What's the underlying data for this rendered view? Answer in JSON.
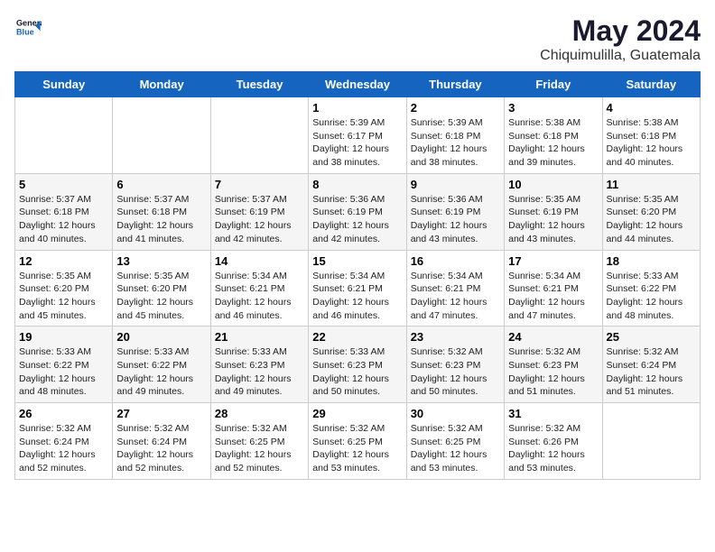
{
  "header": {
    "logo_line1": "General",
    "logo_line2": "Blue",
    "title": "May 2024",
    "subtitle": "Chiquimulilla, Guatemala"
  },
  "calendar": {
    "days_of_week": [
      "Sunday",
      "Monday",
      "Tuesday",
      "Wednesday",
      "Thursday",
      "Friday",
      "Saturday"
    ],
    "weeks": [
      [
        {
          "day": "",
          "content": ""
        },
        {
          "day": "",
          "content": ""
        },
        {
          "day": "",
          "content": ""
        },
        {
          "day": "1",
          "content": "Sunrise: 5:39 AM\nSunset: 6:17 PM\nDaylight: 12 hours\nand 38 minutes."
        },
        {
          "day": "2",
          "content": "Sunrise: 5:39 AM\nSunset: 6:18 PM\nDaylight: 12 hours\nand 38 minutes."
        },
        {
          "day": "3",
          "content": "Sunrise: 5:38 AM\nSunset: 6:18 PM\nDaylight: 12 hours\nand 39 minutes."
        },
        {
          "day": "4",
          "content": "Sunrise: 5:38 AM\nSunset: 6:18 PM\nDaylight: 12 hours\nand 40 minutes."
        }
      ],
      [
        {
          "day": "5",
          "content": "Sunrise: 5:37 AM\nSunset: 6:18 PM\nDaylight: 12 hours\nand 40 minutes."
        },
        {
          "day": "6",
          "content": "Sunrise: 5:37 AM\nSunset: 6:18 PM\nDaylight: 12 hours\nand 41 minutes."
        },
        {
          "day": "7",
          "content": "Sunrise: 5:37 AM\nSunset: 6:19 PM\nDaylight: 12 hours\nand 42 minutes."
        },
        {
          "day": "8",
          "content": "Sunrise: 5:36 AM\nSunset: 6:19 PM\nDaylight: 12 hours\nand 42 minutes."
        },
        {
          "day": "9",
          "content": "Sunrise: 5:36 AM\nSunset: 6:19 PM\nDaylight: 12 hours\nand 43 minutes."
        },
        {
          "day": "10",
          "content": "Sunrise: 5:35 AM\nSunset: 6:19 PM\nDaylight: 12 hours\nand 43 minutes."
        },
        {
          "day": "11",
          "content": "Sunrise: 5:35 AM\nSunset: 6:20 PM\nDaylight: 12 hours\nand 44 minutes."
        }
      ],
      [
        {
          "day": "12",
          "content": "Sunrise: 5:35 AM\nSunset: 6:20 PM\nDaylight: 12 hours\nand 45 minutes."
        },
        {
          "day": "13",
          "content": "Sunrise: 5:35 AM\nSunset: 6:20 PM\nDaylight: 12 hours\nand 45 minutes."
        },
        {
          "day": "14",
          "content": "Sunrise: 5:34 AM\nSunset: 6:21 PM\nDaylight: 12 hours\nand 46 minutes."
        },
        {
          "day": "15",
          "content": "Sunrise: 5:34 AM\nSunset: 6:21 PM\nDaylight: 12 hours\nand 46 minutes."
        },
        {
          "day": "16",
          "content": "Sunrise: 5:34 AM\nSunset: 6:21 PM\nDaylight: 12 hours\nand 47 minutes."
        },
        {
          "day": "17",
          "content": "Sunrise: 5:34 AM\nSunset: 6:21 PM\nDaylight: 12 hours\nand 47 minutes."
        },
        {
          "day": "18",
          "content": "Sunrise: 5:33 AM\nSunset: 6:22 PM\nDaylight: 12 hours\nand 48 minutes."
        }
      ],
      [
        {
          "day": "19",
          "content": "Sunrise: 5:33 AM\nSunset: 6:22 PM\nDaylight: 12 hours\nand 48 minutes."
        },
        {
          "day": "20",
          "content": "Sunrise: 5:33 AM\nSunset: 6:22 PM\nDaylight: 12 hours\nand 49 minutes."
        },
        {
          "day": "21",
          "content": "Sunrise: 5:33 AM\nSunset: 6:23 PM\nDaylight: 12 hours\nand 49 minutes."
        },
        {
          "day": "22",
          "content": "Sunrise: 5:33 AM\nSunset: 6:23 PM\nDaylight: 12 hours\nand 50 minutes."
        },
        {
          "day": "23",
          "content": "Sunrise: 5:32 AM\nSunset: 6:23 PM\nDaylight: 12 hours\nand 50 minutes."
        },
        {
          "day": "24",
          "content": "Sunrise: 5:32 AM\nSunset: 6:23 PM\nDaylight: 12 hours\nand 51 minutes."
        },
        {
          "day": "25",
          "content": "Sunrise: 5:32 AM\nSunset: 6:24 PM\nDaylight: 12 hours\nand 51 minutes."
        }
      ],
      [
        {
          "day": "26",
          "content": "Sunrise: 5:32 AM\nSunset: 6:24 PM\nDaylight: 12 hours\nand 52 minutes."
        },
        {
          "day": "27",
          "content": "Sunrise: 5:32 AM\nSunset: 6:24 PM\nDaylight: 12 hours\nand 52 minutes."
        },
        {
          "day": "28",
          "content": "Sunrise: 5:32 AM\nSunset: 6:25 PM\nDaylight: 12 hours\nand 52 minutes."
        },
        {
          "day": "29",
          "content": "Sunrise: 5:32 AM\nSunset: 6:25 PM\nDaylight: 12 hours\nand 53 minutes."
        },
        {
          "day": "30",
          "content": "Sunrise: 5:32 AM\nSunset: 6:25 PM\nDaylight: 12 hours\nand 53 minutes."
        },
        {
          "day": "31",
          "content": "Sunrise: 5:32 AM\nSunset: 6:26 PM\nDaylight: 12 hours\nand 53 minutes."
        },
        {
          "day": "",
          "content": ""
        }
      ]
    ]
  }
}
